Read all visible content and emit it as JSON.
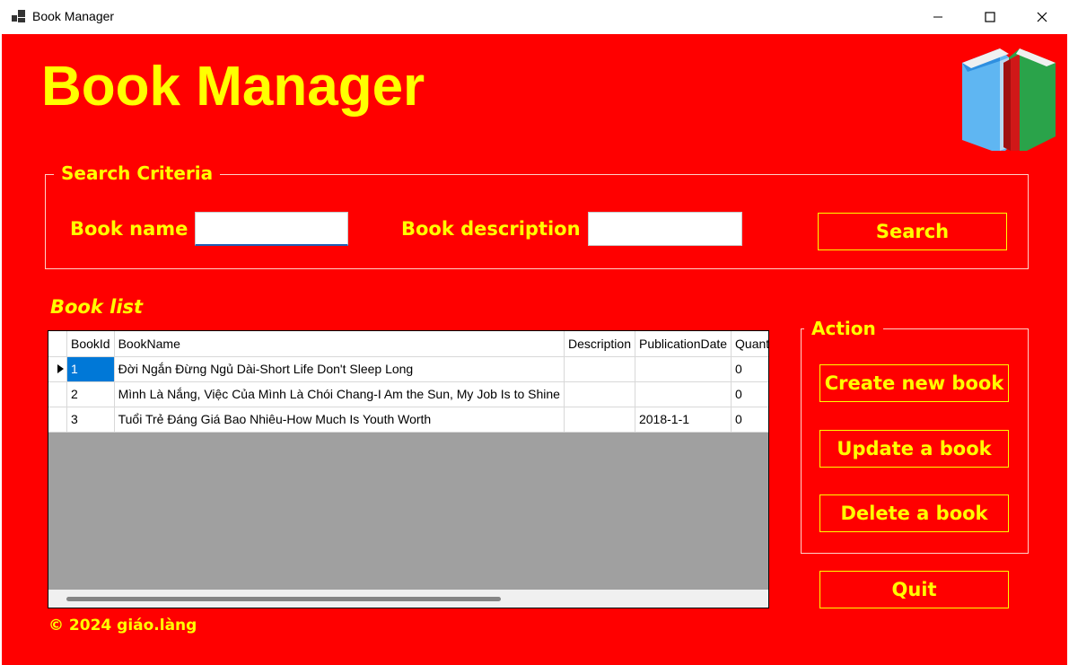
{
  "window": {
    "title": "Book Manager"
  },
  "header": {
    "title": "Book Manager",
    "logo_icon": "book-icon"
  },
  "search": {
    "legend": "Search Criteria",
    "book_name_label": "Book name",
    "book_name_value": "",
    "book_description_label": "Book description",
    "book_description_value": "",
    "search_button": "Search"
  },
  "book_list": {
    "title": "Book list",
    "columns": [
      "BookId",
      "BookName",
      "Description",
      "PublicationDate",
      "Quantity"
    ],
    "rows": [
      {
        "id": "1",
        "name": "Đời Ngắn Đừng Ngủ Dài-Short Life Don't Sleep Long",
        "description": "",
        "date": "",
        "quantity": "0"
      },
      {
        "id": "2",
        "name": "Mình Là Nắng, Việc Của Mình Là Chói Chang-I Am the Sun, My Job Is to Shine",
        "description": "",
        "date": "",
        "quantity": "0"
      },
      {
        "id": "3",
        "name": "Tuổi Trẻ Đáng Giá Bao Nhiêu-How Much Is Youth Worth",
        "description": "",
        "date": "2018-1-1",
        "quantity": "0"
      }
    ]
  },
  "action": {
    "legend": "Action",
    "create_button": "Create new book",
    "update_button": "Update a book",
    "delete_button": "Delete a book"
  },
  "quit_button": "Quit",
  "footer": "© 2024 giáo.làng",
  "colors": {
    "background": "#ff0000",
    "text": "#ffff00",
    "selection": "#0078d7"
  }
}
